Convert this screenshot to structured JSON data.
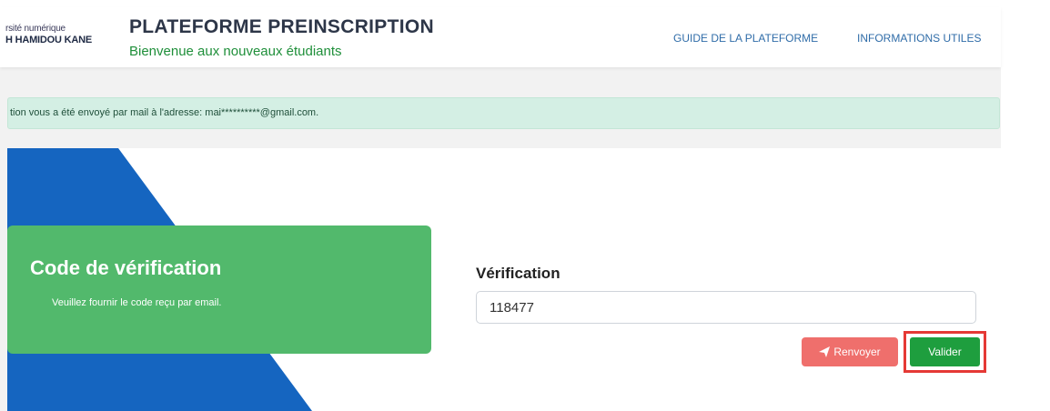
{
  "header": {
    "logo_line1": "rsité numérique",
    "logo_line2": "H HAMIDOU KANE",
    "title": "PLATEFORME PREINSCRIPTION",
    "subtitle": "Bienvenue aux nouveaux étudiants",
    "nav": [
      {
        "label": "GUIDE DE LA PLATEFORME"
      },
      {
        "label": "INFORMATIONS UTILES"
      }
    ]
  },
  "alert": {
    "text": "tion vous a été envoyé par mail à l'adresse: mai**********@gmail.com."
  },
  "panel": {
    "title": "Code de vérification",
    "description": "Veuillez fournir le code reçu par email."
  },
  "form": {
    "label": "Vérification",
    "code_value": "118477",
    "resend_label": "Renvoyer",
    "validate_label": "Valider"
  },
  "colors": {
    "primary_green": "#1e9e3e",
    "panel_green": "#52b96c",
    "resend_red": "#ef6f6c",
    "highlight_red": "#e53935",
    "blue_shape": "#1565c0"
  },
  "icons": {
    "resend": "paper-plane-icon"
  }
}
